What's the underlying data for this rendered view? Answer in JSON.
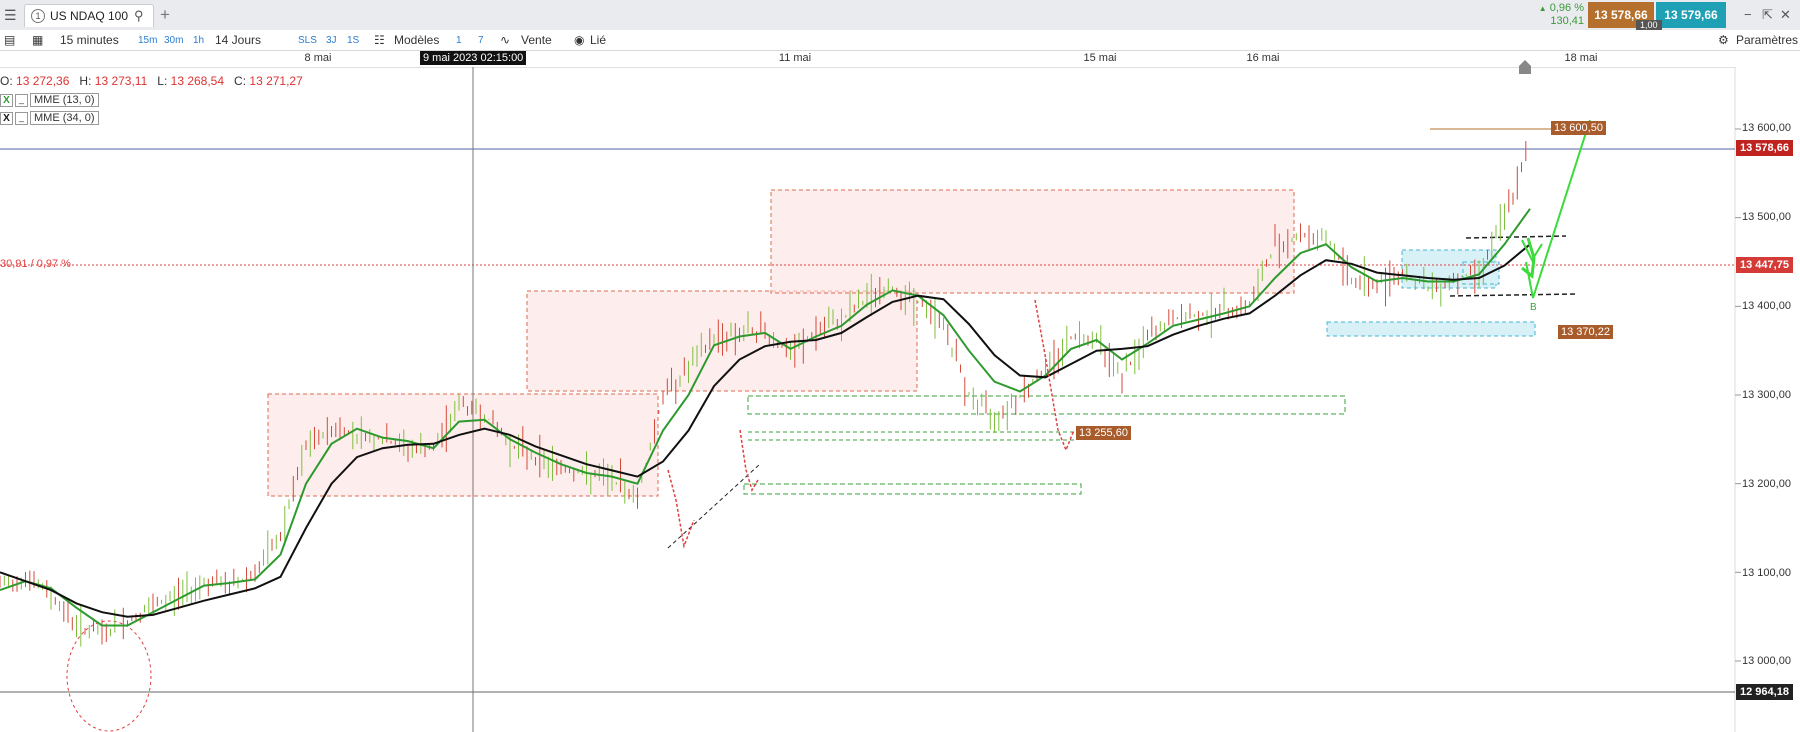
{
  "window": {
    "tab_number": "1",
    "tab_title": "US NDAQ 100",
    "change_pct": "0,96 %",
    "change_abs": "130,41",
    "bid": "13 578,66",
    "ask": "13 579,66",
    "spread": "1,00",
    "accent_bid": "#b5702d",
    "accent_ask": "#1fa0b4"
  },
  "toolbar": {
    "interval": "15 minutes",
    "quick_intervals": [
      "15m",
      "30m",
      "1h"
    ],
    "range": "14 Jours",
    "order_buttons": [
      "SLS",
      "3J",
      "1S"
    ],
    "models": "Modèles",
    "p1": "1",
    "p7": "7",
    "sell": "Vente",
    "linked": "Lié",
    "settings": "Paramètres"
  },
  "ohlc": {
    "o_label": "O:",
    "o": "13 272,36",
    "h_label": "H:",
    "h": "13 273,11",
    "l_label": "L:",
    "l": "13 268,54",
    "c_label": "C:",
    "c": "13 271,27"
  },
  "indicators": [
    {
      "x": "X",
      "m": "_",
      "label": "MME (13, 0)",
      "color": "#2e9a2e"
    },
    {
      "x": "X",
      "m": "_",
      "label": "MME (34, 0)",
      "color": "#111111"
    }
  ],
  "crosshair_date": "9 mai 2023 02:15:00",
  "pct_label": "30,91 / 0,97 %",
  "chart_data": {
    "type": "line",
    "instrument": "US NDAQ 100",
    "x_ticks": [
      "8 mai",
      "11 mai",
      "15 mai",
      "16 mai",
      "18 mai"
    ],
    "y_ticks": [
      "13 600,00",
      "13 500,00",
      "13 400,00",
      "13 300,00",
      "13 200,00",
      "13 100,00",
      "13 000,00"
    ],
    "ylim": [
      12930,
      13670
    ],
    "price_labels": {
      "current": "13 578,66",
      "level": "13 447,75",
      "low": "12 964,18"
    },
    "annotations": {
      "target": "13 600,50",
      "support": "13 370,22",
      "swing_low": "13 255,60",
      "point_b": "B"
    },
    "series": [
      {
        "name": "MME (13, 0)",
        "color": "#2e9a2e",
        "values": [
          13080,
          13090,
          13082,
          13060,
          13040,
          13040,
          13055,
          13070,
          13085,
          13088,
          13092,
          13120,
          13200,
          13245,
          13262,
          13252,
          13248,
          13240,
          13270,
          13272,
          13250,
          13235,
          13222,
          13212,
          13208,
          13200,
          13260,
          13300,
          13356,
          13366,
          13370,
          13352,
          13366,
          13378,
          13402,
          13418,
          13412,
          13390,
          13350,
          13315,
          13304,
          13322,
          13352,
          13362,
          13340,
          13358,
          13378,
          13385,
          13392,
          13400,
          13432,
          13460,
          13470,
          13444,
          13428,
          13432,
          13428,
          13428,
          13436,
          13470,
          13510
        ]
      },
      {
        "name": "MME (34, 0)",
        "color": "#111111",
        "values": [
          13100,
          13090,
          13080,
          13065,
          13055,
          13050,
          13052,
          13060,
          13068,
          13075,
          13082,
          13095,
          13150,
          13200,
          13230,
          13240,
          13244,
          13245,
          13255,
          13262,
          13255,
          13242,
          13232,
          13222,
          13215,
          13208,
          13225,
          13260,
          13310,
          13340,
          13355,
          13360,
          13362,
          13370,
          13388,
          13405,
          13412,
          13408,
          13380,
          13345,
          13322,
          13320,
          13335,
          13350,
          13352,
          13355,
          13368,
          13378,
          13386,
          13392,
          13412,
          13435,
          13452,
          13448,
          13438,
          13435,
          13432,
          13430,
          13432,
          13446,
          13470
        ]
      },
      {
        "name": "",
        "color": "#888888",
        "values": [
          13085,
          13095,
          13075,
          13040,
          13030,
          13045,
          13060,
          13075,
          13090,
          13085,
          13100,
          13140,
          13240,
          13262,
          13256,
          13250,
          13240,
          13238,
          13290,
          13278,
          13245,
          13230,
          13218,
          13210,
          13205,
          13185,
          13300,
          13330,
          13365,
          13370,
          13372,
          13345,
          13370,
          13385,
          13410,
          13420,
          13405,
          13380,
          13300,
          13275,
          13300,
          13330,
          13365,
          13368,
          13320,
          13365,
          13385,
          13390,
          13395,
          13400,
          13470,
          13480,
          13478,
          13430,
          13425,
          13440,
          13420,
          13430,
          13440,
          13500,
          13578
        ]
      }
    ]
  }
}
